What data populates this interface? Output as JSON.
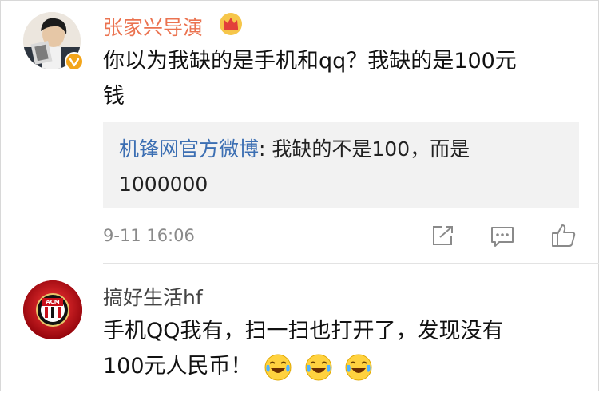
{
  "comment1": {
    "username": "张家兴导演",
    "text_line1": "你以为我缺的是手机和qq？我缺的是100元",
    "text_line2": "钱",
    "quote": {
      "author": "机锋网官方微博",
      "text_line1": ": 我缺的不是100，而是",
      "text_line2": "1000000"
    },
    "timestamp": "9-11 16:06"
  },
  "comment2": {
    "username": "搞好生活hf",
    "text_line1": "手机QQ我有，扫一扫也打开了，发现没有",
    "text_line2": "100元人民币！"
  },
  "colors": {
    "username_accent": "#eb7350",
    "link_blue": "#3c6fb3",
    "verified_badge": "#f3a51b"
  },
  "icons": [
    "crown-icon",
    "verified-badge-icon",
    "share-icon",
    "comment-icon",
    "like-icon",
    "laughing-crying-emoji"
  ]
}
